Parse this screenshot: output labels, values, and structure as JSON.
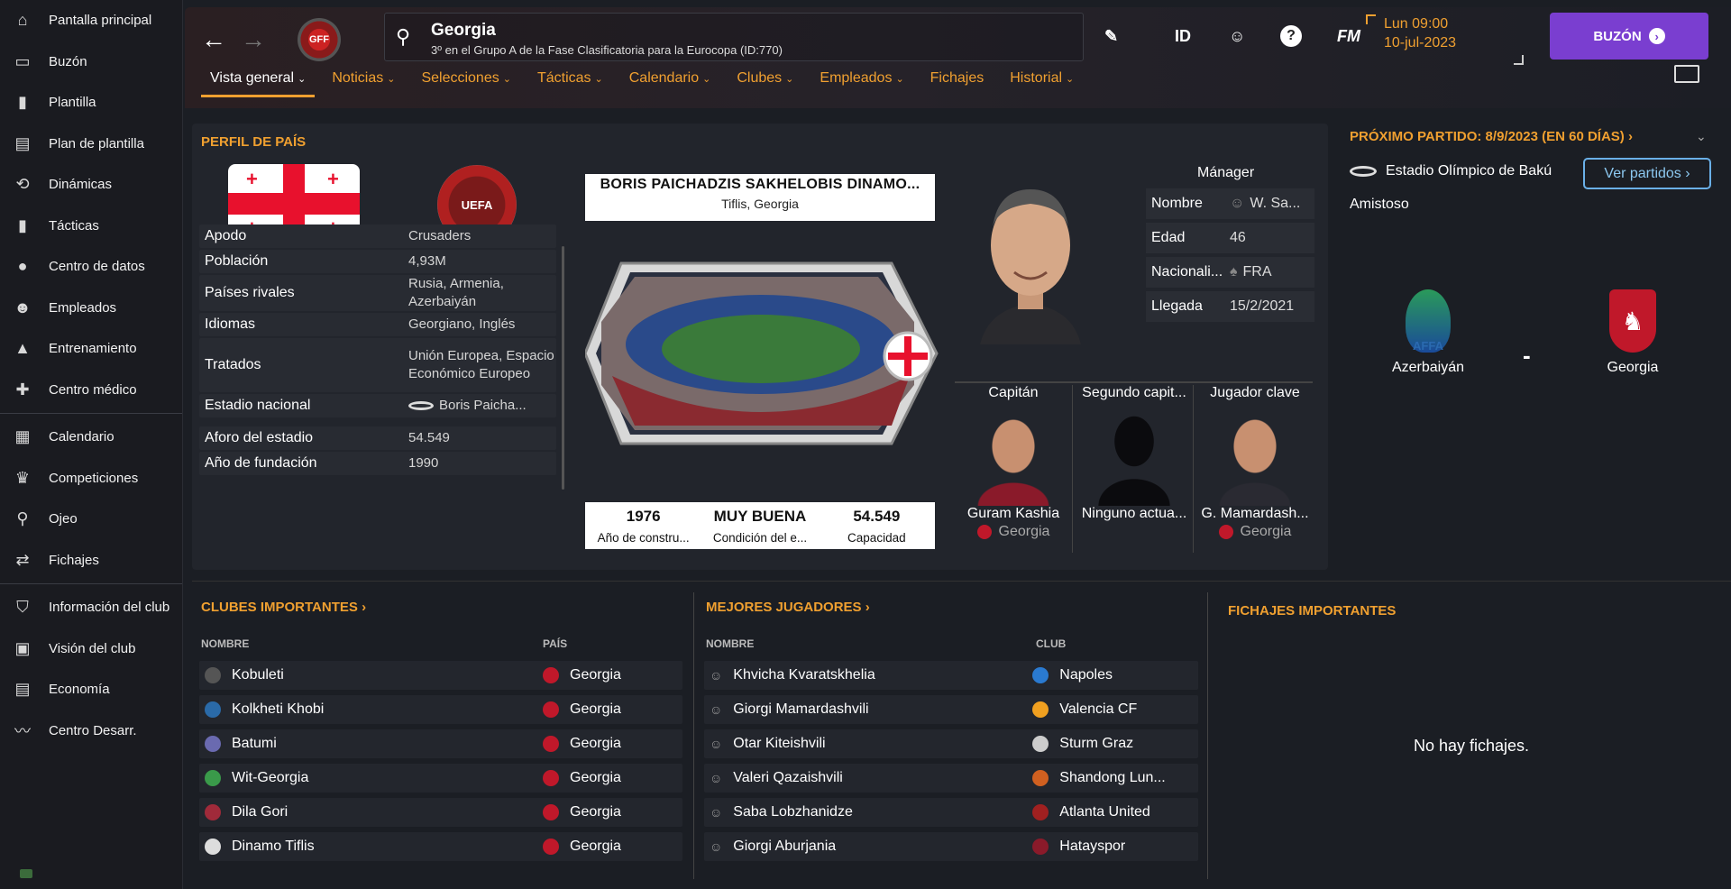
{
  "sidebar": {
    "items": [
      {
        "label": "Pantalla principal",
        "icon": "home-icon"
      },
      {
        "label": "Buzón",
        "icon": "inbox-icon"
      },
      {
        "label": "Plantilla",
        "icon": "shirt-icon"
      },
      {
        "label": "Plan de plantilla",
        "icon": "clipboard-icon"
      },
      {
        "label": "Dinámicas",
        "icon": "dynamics-icon"
      },
      {
        "label": "Tácticas",
        "icon": "tactics-icon"
      },
      {
        "label": "Centro de datos",
        "icon": "data-icon"
      },
      {
        "label": "Empleados",
        "icon": "staff-icon"
      },
      {
        "label": "Entrenamiento",
        "icon": "training-icon"
      },
      {
        "label": "Centro médico",
        "icon": "medical-icon"
      },
      {
        "label": "Calendario",
        "icon": "calendar-icon"
      },
      {
        "label": "Competiciones",
        "icon": "trophy-icon"
      },
      {
        "label": "Ojeo",
        "icon": "scout-icon"
      },
      {
        "label": "Fichajes",
        "icon": "transfers-icon"
      },
      {
        "label": "Información del club",
        "icon": "club-info-icon"
      },
      {
        "label": "Visión del club",
        "icon": "club-vision-icon"
      },
      {
        "label": "Economía",
        "icon": "finance-icon"
      },
      {
        "label": "Centro Desarr.",
        "icon": "development-icon"
      }
    ]
  },
  "header": {
    "crest": "GFF",
    "title": "Georgia",
    "subtitle": "3º en el Grupo A de la Fase Clasificatoria para la Eurocopa (ID:770)",
    "id_label": "ID",
    "fm_label": "FM",
    "help_label": "?",
    "date_line1": "Lun 09:00",
    "date_line2": "10-jul-2023",
    "inbox_button": "BUZÓN",
    "accent": "#f0a030",
    "button_color": "#7a3ed0"
  },
  "tabs": [
    {
      "label": "Vista general",
      "dropdown": true
    },
    {
      "label": "Noticias",
      "dropdown": true
    },
    {
      "label": "Selecciones",
      "dropdown": true
    },
    {
      "label": "Tácticas",
      "dropdown": true
    },
    {
      "label": "Calendario",
      "dropdown": true
    },
    {
      "label": "Clubes",
      "dropdown": true
    },
    {
      "label": "Empleados",
      "dropdown": true
    },
    {
      "label": "Fichajes",
      "dropdown": false
    },
    {
      "label": "Historial",
      "dropdown": true
    }
  ],
  "profile": {
    "heading": "PERFIL DE PAÍS",
    "uefa_label": "UEFA",
    "rows": [
      {
        "k": "Apodo",
        "v": "Crusaders"
      },
      {
        "k": "Población",
        "v": "4,93M"
      },
      {
        "k": "Países rivales",
        "v": "Rusia, Armenia, Azerbaiyán"
      },
      {
        "k": "Idiomas",
        "v": "Georgiano, Inglés"
      },
      {
        "k": "Tratados",
        "v": "Unión Europea, Espacio Económico Europeo"
      },
      {
        "k": "Estadio nacional",
        "v": "Boris Paicha..."
      },
      {
        "k": "Aforo del estadio",
        "v": "54.549"
      },
      {
        "k": "Año de fundación",
        "v": "1990"
      }
    ]
  },
  "stadium": {
    "name": "BORIS PAICHADZIS SAKHELOBIS DINAMO...",
    "location": "Tiflis, Georgia",
    "stats": [
      {
        "n": "1976",
        "l": "Año de constru..."
      },
      {
        "n": "MUY BUENA",
        "l": "Condición del e..."
      },
      {
        "n": "54.549",
        "l": "Capacidad"
      }
    ]
  },
  "manager": {
    "title": "Mánager",
    "rows": [
      {
        "k": "Nombre",
        "v": "W. Sa..."
      },
      {
        "k": "Edad",
        "v": "46"
      },
      {
        "k": "Nacionali...",
        "v": "FRA"
      },
      {
        "k": "Llegada",
        "v": "15/2/2021"
      }
    ]
  },
  "key_people": [
    {
      "role": "Capitán",
      "name": "Guram Kashia",
      "country": "Georgia"
    },
    {
      "role": "Segundo capit...",
      "name": "Ninguno actua...",
      "country": ""
    },
    {
      "role": "Jugador clave",
      "name": "G. Mamardash...",
      "country": "Georgia"
    }
  ],
  "next_match": {
    "heading": "PRÓXIMO PARTIDO: 8/9/2023 (EN 60 DÍAS)",
    "venue": "Estadio Olímpico de Bakú",
    "type": "Amistoso",
    "button": "Ver partidos",
    "home": "Azerbaiyán",
    "home_crest": "AFFA",
    "away": "Georgia",
    "separator": "-"
  },
  "clubs": {
    "heading": "CLUBES IMPORTANTES",
    "col1": "NOMBRE",
    "col2": "PAÍS",
    "rows": [
      {
        "name": "Kobuleti",
        "country": "Georgia",
        "color": "#555"
      },
      {
        "name": "Kolkheti Khobi",
        "country": "Georgia",
        "color": "#2a6aa8"
      },
      {
        "name": "Batumi",
        "country": "Georgia",
        "color": "#6a6ab0"
      },
      {
        "name": "Wit-Georgia",
        "country": "Georgia",
        "color": "#3a9a4a"
      },
      {
        "name": "Dila Gori",
        "country": "Georgia",
        "color": "#a02a3a"
      },
      {
        "name": "Dinamo Tiflis",
        "country": "Georgia",
        "color": "#ddd"
      }
    ]
  },
  "players": {
    "heading": "MEJORES JUGADORES",
    "col1": "NOMBRE",
    "col2": "CLUB",
    "rows": [
      {
        "name": "Khvicha Kvaratskhelia",
        "club": "Napoles",
        "color": "#2a7ad0"
      },
      {
        "name": "Giorgi Mamardashvili",
        "club": "Valencia CF",
        "color": "#f0a020"
      },
      {
        "name": "Otar Kiteishvili",
        "club": "Sturm Graz",
        "color": "#ccc"
      },
      {
        "name": "Valeri Qazaishvili",
        "club": "Shandong Lun...",
        "color": "#d06020"
      },
      {
        "name": "Saba Lobzhanidze",
        "club": "Atlanta United",
        "color": "#a02020"
      },
      {
        "name": "Giorgi Aburjania",
        "club": "Hatayspor",
        "color": "#8a1a2a"
      }
    ]
  },
  "transfers": {
    "heading": "FICHAJES IMPORTANTES",
    "empty": "No hay fichajes."
  }
}
